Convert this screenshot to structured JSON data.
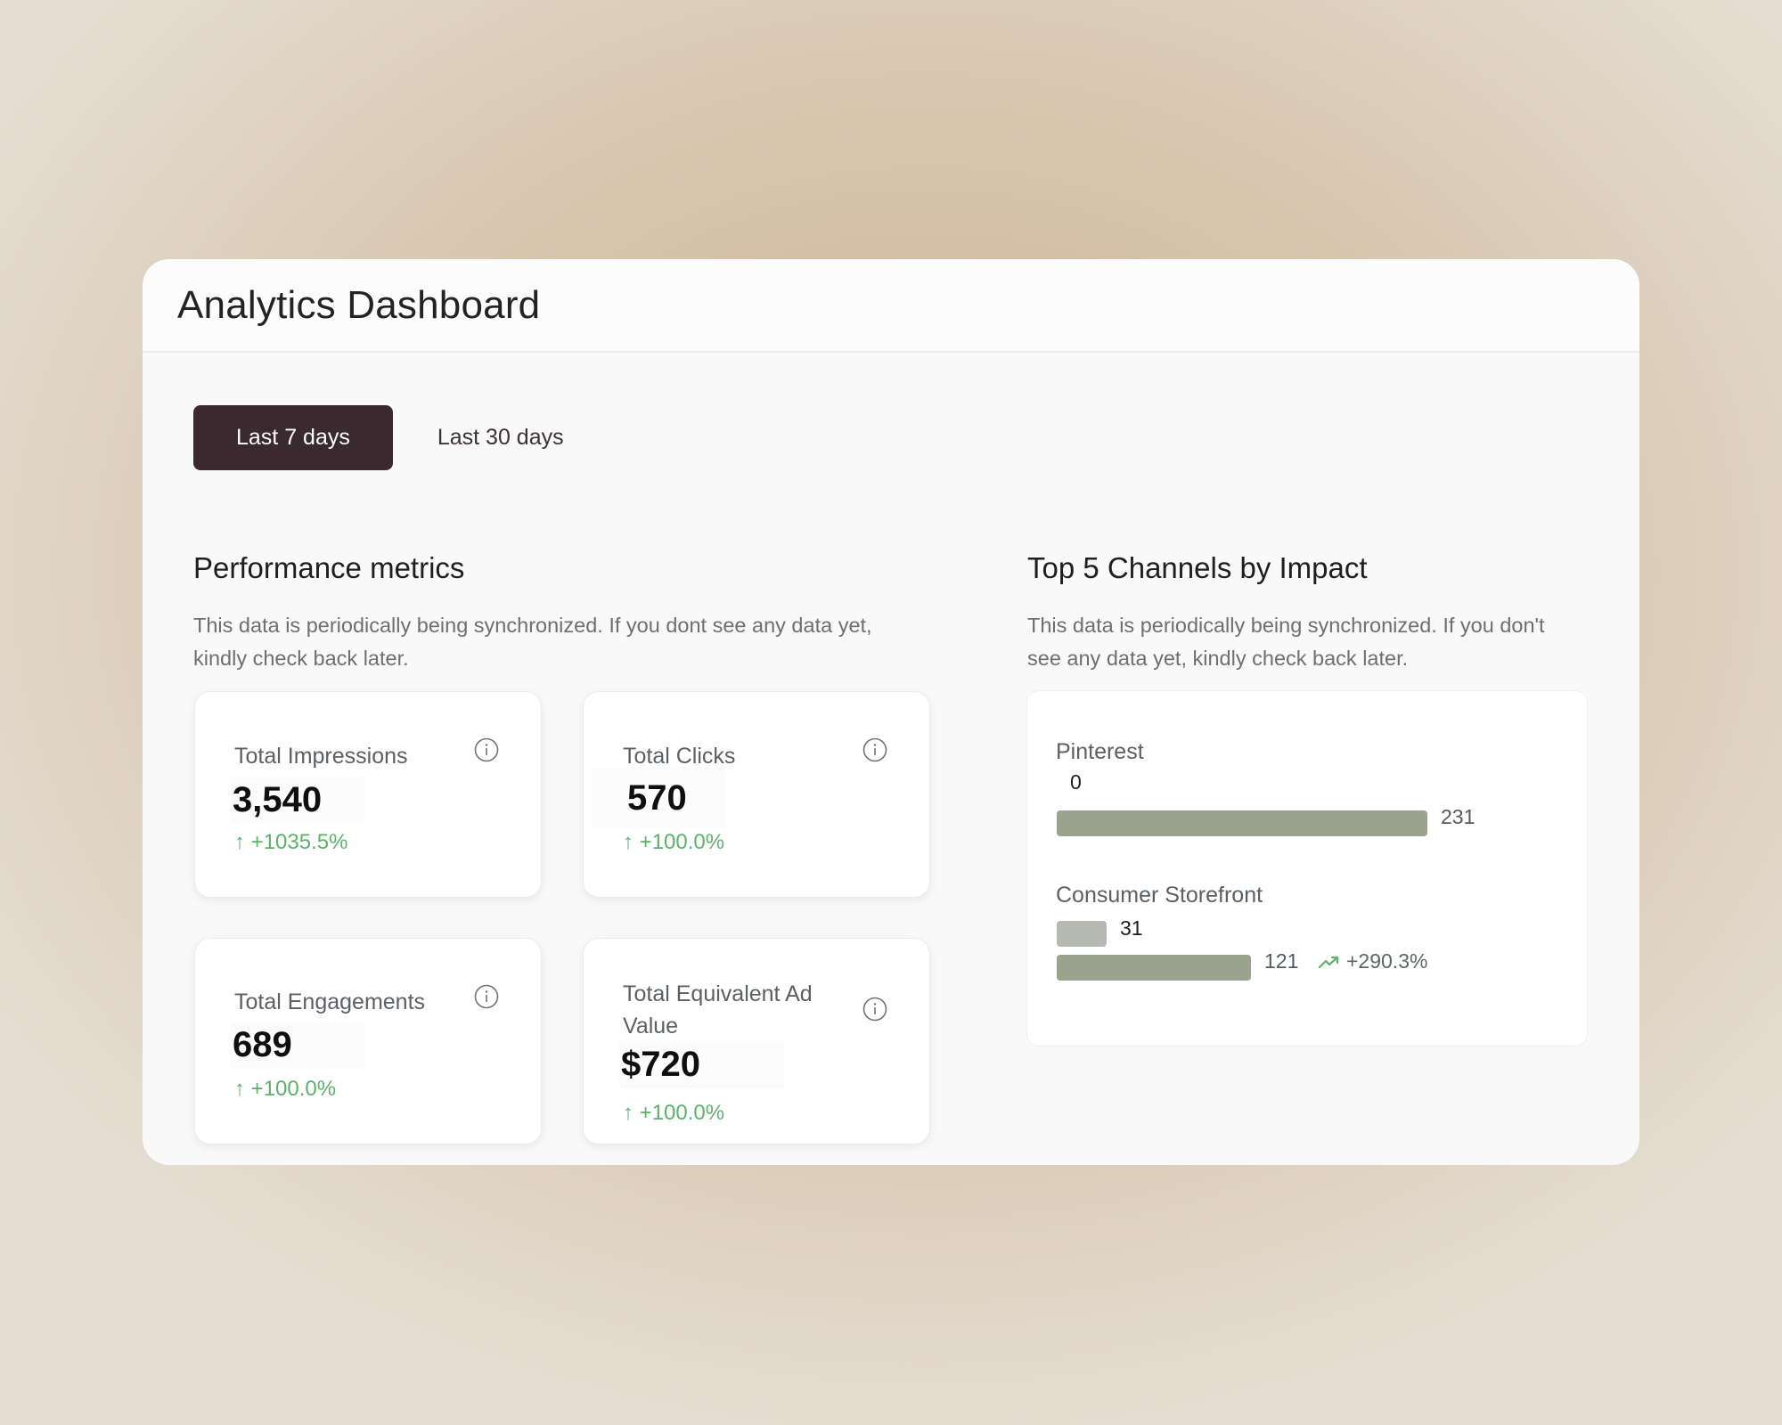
{
  "app": {
    "title": "Analytics Dashboard"
  },
  "tabs": [
    {
      "label": "Last 7 days",
      "active": true
    },
    {
      "label": "Last 30 days",
      "active": false
    }
  ],
  "performance": {
    "title": "Performance metrics",
    "description_line1": "This data is periodically being synchronized. If you dont see any data yet,",
    "description_line2": "kindly check back later.",
    "metrics": [
      {
        "label": "Total Impressions",
        "value": "3,540",
        "change": "+1035.5%"
      },
      {
        "label": "Total Clicks",
        "value": "570",
        "change": "+100.0%"
      },
      {
        "label": "Total Engagements",
        "value": "689",
        "change": "+100.0%"
      },
      {
        "label_line1": "Total Equivalent Ad",
        "label_line2": "Value",
        "value": "$720",
        "change": "+100.0%"
      }
    ],
    "change_arrow": "↑"
  },
  "channels": {
    "title": "Top 5 Channels by Impact",
    "description_line1": "This data is periodically being synchronized. If you don't",
    "description_line2": "see any data yet, kindly check back later.",
    "items": [
      {
        "name": "Pinterest",
        "previous": "0",
        "current": "231"
      },
      {
        "name": "Consumer Storefront",
        "previous": "31",
        "current": "121",
        "change": "+290.3%"
      }
    ]
  },
  "colors": {
    "active_tab": "#3a2a2f",
    "positive": "#5cb26b",
    "bar_current": "#9aa38d",
    "bar_previous": "#b5b9af"
  },
  "icons": [
    "info-icon",
    "trending-up-icon"
  ]
}
